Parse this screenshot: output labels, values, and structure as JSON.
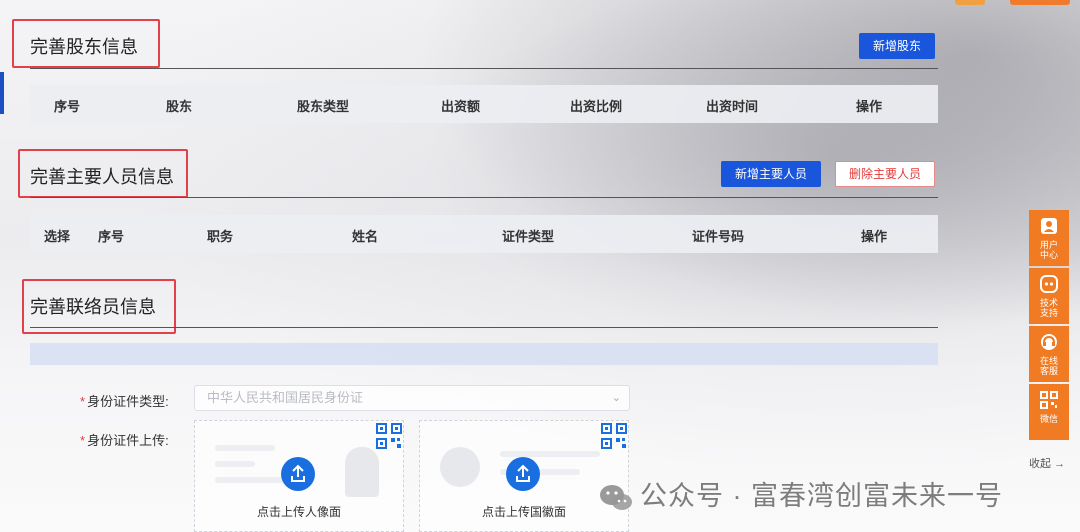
{
  "sections": {
    "shareholders": {
      "title": "完善股东信息",
      "add_button": "新增股东",
      "columns": [
        "序号",
        "股东",
        "股东类型",
        "出资额",
        "出资比例",
        "出资时间",
        "操作"
      ]
    },
    "key_personnel": {
      "title": "完善主要人员信息",
      "add_button": "新增主要人员",
      "delete_button": "删除主要人员",
      "columns": [
        "选择",
        "序号",
        "职务",
        "姓名",
        "证件类型",
        "证件号码",
        "操作"
      ]
    },
    "contact": {
      "title": "完善联络员信息",
      "id_type_label": "身份证件类型:",
      "id_type_value": "中华人民共和国居民身份证",
      "id_upload_label": "身份证件上传:",
      "upload_front": "点击上传人像面",
      "upload_back": "点击上传国徽面"
    }
  },
  "side_tools": [
    {
      "label_top": "用户",
      "label_bottom": "中心",
      "icon": "user-icon"
    },
    {
      "label_top": "技术",
      "label_bottom": "支持",
      "icon": "support-icon"
    },
    {
      "label_top": "在线",
      "label_bottom": "客服",
      "icon": "headset-icon"
    },
    {
      "label_top": "微信",
      "label_bottom": "",
      "icon": "qr-icon"
    }
  ],
  "collapse_label": "收起 →",
  "watermark": "公众号 · 富春湾创富未来一号",
  "colors": {
    "primary": "#1a56db",
    "danger": "#e23b3b",
    "highlight_box": "#e2404a",
    "side_orange": "#f07b22"
  }
}
